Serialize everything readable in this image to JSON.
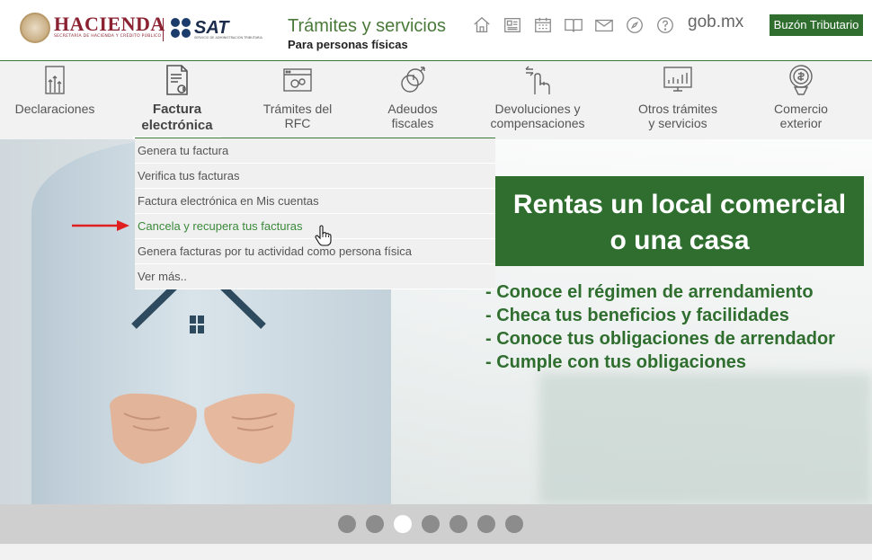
{
  "header": {
    "logo_hacienda": "HACIENDA",
    "logo_hacienda_sub": "SECRETARÍA DE HACIENDA Y CRÉDITO PÚBLICO",
    "logo_sat": "SAT",
    "logo_sat_sub": "SERVICIO DE ADMINISTRACIÓN TRIBUTARIA",
    "title": "Trámites y servicios",
    "subtitle": "Para personas físicas",
    "gobmx": "gob.mx",
    "buzon": "Buzón Tributario",
    "icons": [
      "home-icon",
      "news-icon",
      "calendar-icon",
      "book-icon",
      "mail-icon",
      "compass-icon",
      "help-icon"
    ]
  },
  "nav": {
    "items": [
      {
        "line1": "Declaraciones",
        "line2": "",
        "icon": "declaraciones-icon"
      },
      {
        "line1": "Factura",
        "line2": "electrónica",
        "icon": "factura-icon"
      },
      {
        "line1": "Trámites del",
        "line2": "RFC",
        "icon": "rfc-icon"
      },
      {
        "line1": "Adeudos",
        "line2": "fiscales",
        "icon": "adeudos-icon"
      },
      {
        "line1": "Devoluciones y",
        "line2": "compensaciones",
        "icon": "devoluciones-icon"
      },
      {
        "line1": "Otros trámites",
        "line2": "y servicios",
        "icon": "otros-icon"
      },
      {
        "line1": "Comercio",
        "line2": "exterior",
        "icon": "comercio-icon"
      }
    ]
  },
  "dropdown": {
    "items": [
      "Genera tu factura",
      "Verifica tus facturas",
      "Factura electrónica en Mis cuentas",
      "Cancela y recupera tus facturas",
      "Genera facturas por tu actividad como persona física",
      "Ver más.."
    ]
  },
  "banner": {
    "headline_1": "Rentas un local comercial",
    "headline_2": "o una casa",
    "bullets": [
      "- Conoce el régimen de arrendamiento",
      "- Checa tus beneficios y facilidades",
      "- Conoce tus obligaciones de arrendador",
      "- Cumple con tus obligaciones"
    ]
  },
  "carousel": {
    "slides": 7,
    "active_index": 3
  },
  "colors": {
    "accent_green": "#2f6e2f",
    "hacienda_red": "#8b2231",
    "link_green": "#3a8a3a"
  }
}
